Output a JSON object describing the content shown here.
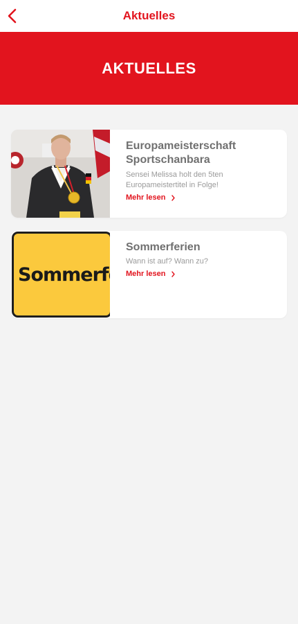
{
  "header": {
    "title": "Aktuelles",
    "back_icon": "chevron-left-icon"
  },
  "banner": {
    "title": "AKTUELLES"
  },
  "news": [
    {
      "title": "Europameisterschaft Sportschanbara",
      "text": "Sensei Melissa holt den 5ten Europameistertitel in Folge!",
      "link_label": "Mehr lesen"
    },
    {
      "title": "Sommerferien",
      "text": "Wann ist auf? Wann zu?",
      "link_label": "Mehr lesen",
      "image_text": "Sommerfer"
    }
  ],
  "colors": {
    "accent": "#e2141e",
    "background": "#f3f3f3",
    "card": "#ffffff"
  }
}
